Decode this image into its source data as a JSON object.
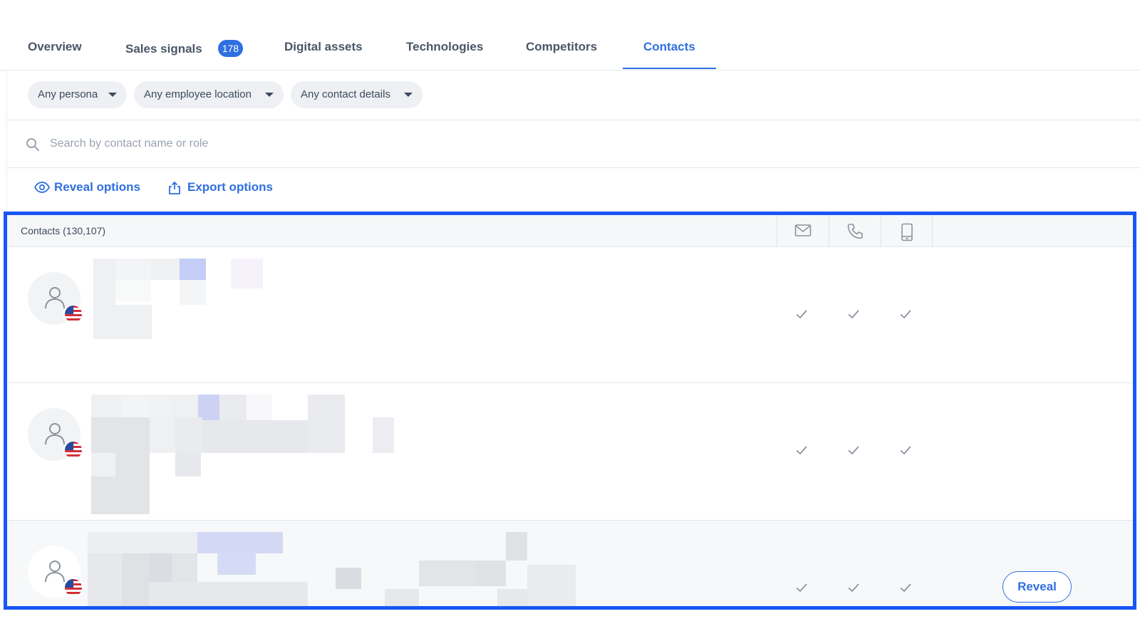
{
  "tabs": [
    {
      "label": "Overview"
    },
    {
      "label": "Sales signals",
      "badge": "178"
    },
    {
      "label": "Digital assets"
    },
    {
      "label": "Technologies"
    },
    {
      "label": "Competitors"
    },
    {
      "label": "Contacts",
      "active": true
    }
  ],
  "filters": {
    "persona": "Any persona",
    "location": "Any employee location",
    "contact_details": "Any contact details"
  },
  "search": {
    "placeholder": "Search by contact name or role",
    "value": ""
  },
  "actions": {
    "reveal": "Reveal options",
    "export": "Export options"
  },
  "table": {
    "title": "Contacts (130,107)",
    "columns": [
      "email-icon",
      "phone-icon",
      "mobile-icon"
    ],
    "rows": [
      {
        "country": "US",
        "email": true,
        "phone": true,
        "mobile": true
      },
      {
        "country": "US",
        "email": true,
        "phone": true,
        "mobile": true
      },
      {
        "country": "US",
        "email": true,
        "phone": true,
        "mobile": true,
        "action": "Reveal"
      }
    ]
  },
  "colors": {
    "accent": "#2f6fe0",
    "highlight_frame": "#1856f5",
    "text": "#3d4a5c"
  }
}
